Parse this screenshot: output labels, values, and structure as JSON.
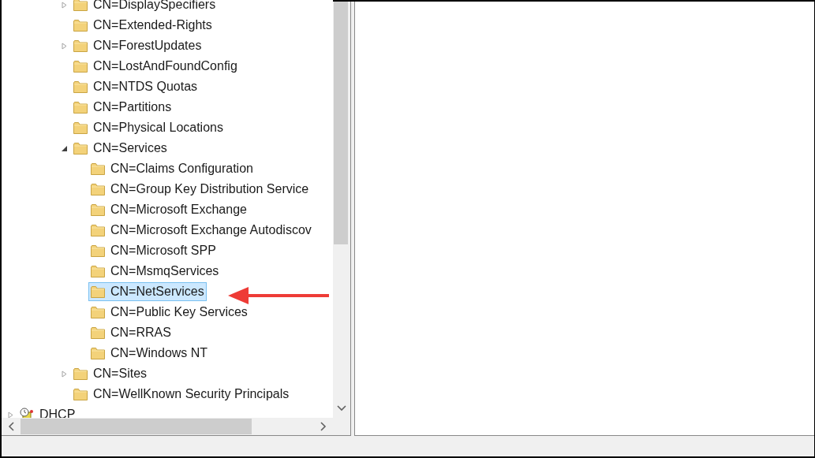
{
  "tree": {
    "items": [
      {
        "label": "CN=DisplaySpecifiers",
        "kind": "folder",
        "expandable": true,
        "expanded": false,
        "selected": false
      },
      {
        "label": "CN=Extended-Rights",
        "kind": "folder",
        "expandable": false,
        "expanded": false,
        "selected": false
      },
      {
        "label": "CN=ForestUpdates",
        "kind": "folder",
        "expandable": true,
        "expanded": false,
        "selected": false
      },
      {
        "label": "CN=LostAndFoundConfig",
        "kind": "folder",
        "expandable": false,
        "expanded": false,
        "selected": false
      },
      {
        "label": "CN=NTDS Quotas",
        "kind": "folder",
        "expandable": false,
        "expanded": false,
        "selected": false
      },
      {
        "label": "CN=Partitions",
        "kind": "folder",
        "expandable": false,
        "expanded": false,
        "selected": false
      },
      {
        "label": "CN=Physical Locations",
        "kind": "folder",
        "expandable": false,
        "expanded": false,
        "selected": false
      },
      {
        "label": "CN=Services",
        "kind": "folder",
        "expandable": true,
        "expanded": true,
        "selected": false,
        "children": [
          {
            "label": "CN=Claims Configuration",
            "kind": "folder",
            "expandable": false,
            "expanded": false,
            "selected": false
          },
          {
            "label": "CN=Group Key Distribution Service",
            "kind": "folder",
            "expandable": false,
            "expanded": false,
            "selected": false
          },
          {
            "label": "CN=Microsoft Exchange",
            "kind": "folder",
            "expandable": false,
            "expanded": false,
            "selected": false
          },
          {
            "label": "CN=Microsoft Exchange Autodiscov",
            "kind": "folder",
            "expandable": false,
            "expanded": false,
            "selected": false
          },
          {
            "label": "CN=Microsoft SPP",
            "kind": "folder",
            "expandable": false,
            "expanded": false,
            "selected": false
          },
          {
            "label": "CN=MsmqServices",
            "kind": "folder",
            "expandable": false,
            "expanded": false,
            "selected": false
          },
          {
            "label": "CN=NetServices",
            "kind": "folder",
            "expandable": false,
            "expanded": false,
            "selected": true
          },
          {
            "label": "CN=Public Key Services",
            "kind": "folder",
            "expandable": false,
            "expanded": false,
            "selected": false
          },
          {
            "label": "CN=RRAS",
            "kind": "folder",
            "expandable": false,
            "expanded": false,
            "selected": false
          },
          {
            "label": "CN=Windows NT",
            "kind": "folder",
            "expandable": false,
            "expanded": false,
            "selected": false
          }
        ]
      },
      {
        "label": "CN=Sites",
        "kind": "folder",
        "expandable": true,
        "expanded": false,
        "selected": false
      },
      {
        "label": "CN=WellKnown Security Principals",
        "kind": "folder",
        "expandable": false,
        "expanded": false,
        "selected": false
      }
    ],
    "next_root": {
      "label": "DHCP",
      "kind": "server",
      "expandable": true,
      "expanded": false,
      "selected": false
    }
  }
}
